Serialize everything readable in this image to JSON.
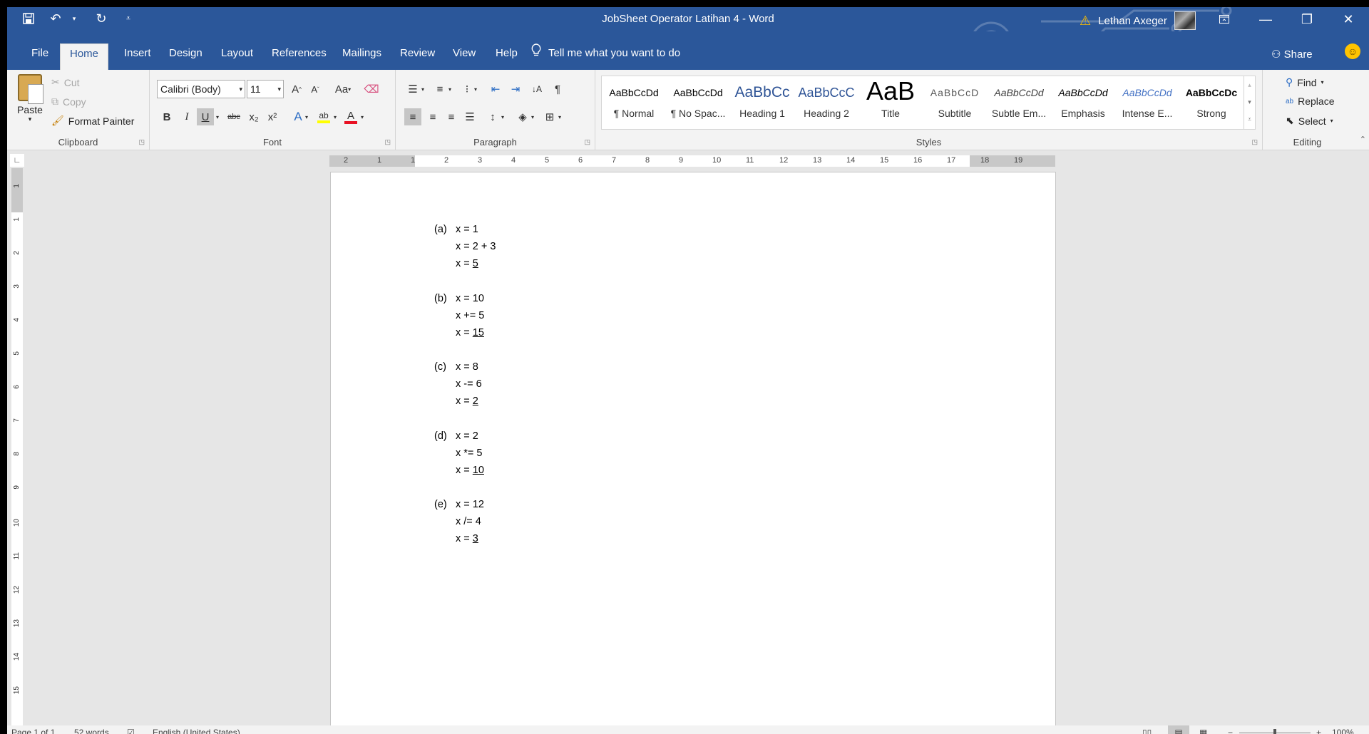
{
  "window": {
    "title": "JobSheet Operator Latihan 4  -  Word",
    "user_name": "Lethan Axeger",
    "warning_icon": "warning-icon",
    "controls": [
      "ribbon-display-options-icon",
      "minimize-icon",
      "restore-icon",
      "close-icon"
    ]
  },
  "qat": {
    "icons": [
      "save-icon",
      "undo-icon",
      "repeat-icon",
      "customize-qat-icon"
    ]
  },
  "tabs": [
    "File",
    "Home",
    "Insert",
    "Design",
    "Layout",
    "References",
    "Mailings",
    "Review",
    "View",
    "Help"
  ],
  "active_tab": "Home",
  "tell_me": "Tell me what you want to do",
  "share": "Share",
  "clipboard": {
    "paste": "Paste",
    "cut": "Cut",
    "copy": "Copy",
    "format_painter": "Format Painter",
    "label": "Clipboard"
  },
  "font": {
    "family": "Calibri (Body)",
    "size": "11",
    "label": "Font",
    "change_case": "Aa",
    "bold": "B",
    "italic": "I",
    "underline": "U",
    "strike": "abc",
    "subscript": "x₂",
    "superscript": "x²"
  },
  "paragraph": {
    "label": "Paragraph"
  },
  "styles": {
    "label": "Styles",
    "items": [
      {
        "preview": "AaBbCcDd",
        "name": "¶ Normal"
      },
      {
        "preview": "AaBbCcDd",
        "name": "¶ No Spac..."
      },
      {
        "preview": "AaBbCc",
        "name": "Heading 1"
      },
      {
        "preview": "AaBbCcC",
        "name": "Heading 2"
      },
      {
        "preview": "AaB",
        "name": "Title"
      },
      {
        "preview": "AaBbCcD",
        "name": "Subtitle"
      },
      {
        "preview": "AaBbCcDd",
        "name": "Subtle Em..."
      },
      {
        "preview": "AaBbCcDd",
        "name": "Emphasis"
      },
      {
        "preview": "AaBbCcDd",
        "name": "Intense E..."
      },
      {
        "preview": "AaBbCcDc",
        "name": "Strong"
      }
    ]
  },
  "editing": {
    "find": "Find",
    "replace": "Replace",
    "select": "Select",
    "label": "Editing"
  },
  "ruler": {
    "numbers": [
      "2",
      "1",
      "1",
      "2",
      "3",
      "4",
      "5",
      "6",
      "7",
      "8",
      "9",
      "10",
      "11",
      "12",
      "13",
      "14",
      "15",
      "16",
      "17",
      "18",
      "19"
    ],
    "vnumbers": [
      "1",
      "1",
      "2",
      "3",
      "4",
      "5",
      "6",
      "7",
      "8",
      "9",
      "10",
      "11",
      "12",
      "13",
      "14",
      "15"
    ]
  },
  "document": {
    "exercises": [
      {
        "label": "(a)",
        "lines": [
          "x = 1",
          "x = 2 + 3"
        ],
        "result_prefix": "x = ",
        "result": "5"
      },
      {
        "label": "(b)",
        "lines": [
          "x = 10",
          "x += 5"
        ],
        "result_prefix": "x = ",
        "result": "15"
      },
      {
        "label": "(c)",
        "lines": [
          "x = 8",
          "x -= 6"
        ],
        "result_prefix": "x = ",
        "result": "2"
      },
      {
        "label": "(d)",
        "lines": [
          "x = 2",
          "x *= 5"
        ],
        "result_prefix": "x = ",
        "result": "10"
      },
      {
        "label": "(e)",
        "lines": [
          "x = 12",
          "x /= 4"
        ],
        "result_prefix": "x = ",
        "result": "3"
      }
    ]
  },
  "status": {
    "page": "Page 1 of 1",
    "words": "52 words",
    "language": "English (United States)",
    "zoom": "100%"
  },
  "colors": {
    "titlebar": "#2b579a",
    "ribbon": "#f3f3f3",
    "canvas": "#e6e6e6",
    "font_color_bar": "#e81123",
    "highlight_bar": "#ffff00"
  }
}
